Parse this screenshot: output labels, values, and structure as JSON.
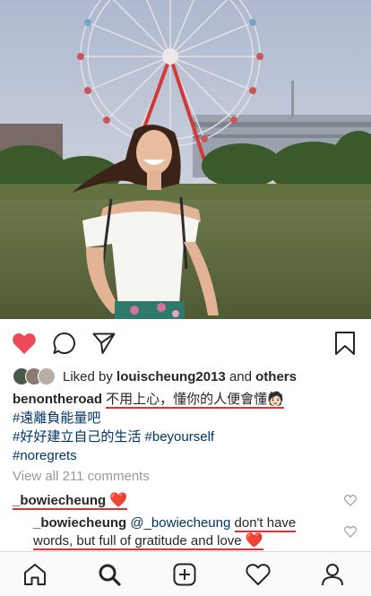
{
  "post": {
    "photo_alt": "photo",
    "liked": {
      "prefix": "Liked by",
      "user": "louischeung2013",
      "middle": "and",
      "others": "others"
    },
    "caption": {
      "user": "benontheroad",
      "text": "不用上心，懂你的人便會懂",
      "emoji": "🧑🏻",
      "tag1": "#遠離負能量吧",
      "tag2": "#好好建立自己的生活",
      "tag3": "#beyourself",
      "tag4": "#noregrets"
    },
    "view_all": "View all 211 comments",
    "comments": [
      {
        "user": "_bowiecheung",
        "text": "",
        "emoji": "❤️"
      },
      {
        "user": "_bowiecheung",
        "mention": "@_bowiecheung",
        "text_a": "don't have",
        "text_b": "words, but full of gratitude and love",
        "emoji": "❤️"
      }
    ]
  },
  "icons": {
    "like": "heart-filled-icon",
    "comment": "comment-bubble-icon",
    "share": "paper-plane-icon",
    "save": "bookmark-icon",
    "nav": [
      "home-icon",
      "search-icon",
      "add-post-icon",
      "activity-heart-icon",
      "profile-icon"
    ]
  },
  "colors": {
    "like_red": "#ed4956",
    "link_blue": "#003569",
    "muted_gray": "#999999",
    "annotation_red": "#e0303a"
  }
}
